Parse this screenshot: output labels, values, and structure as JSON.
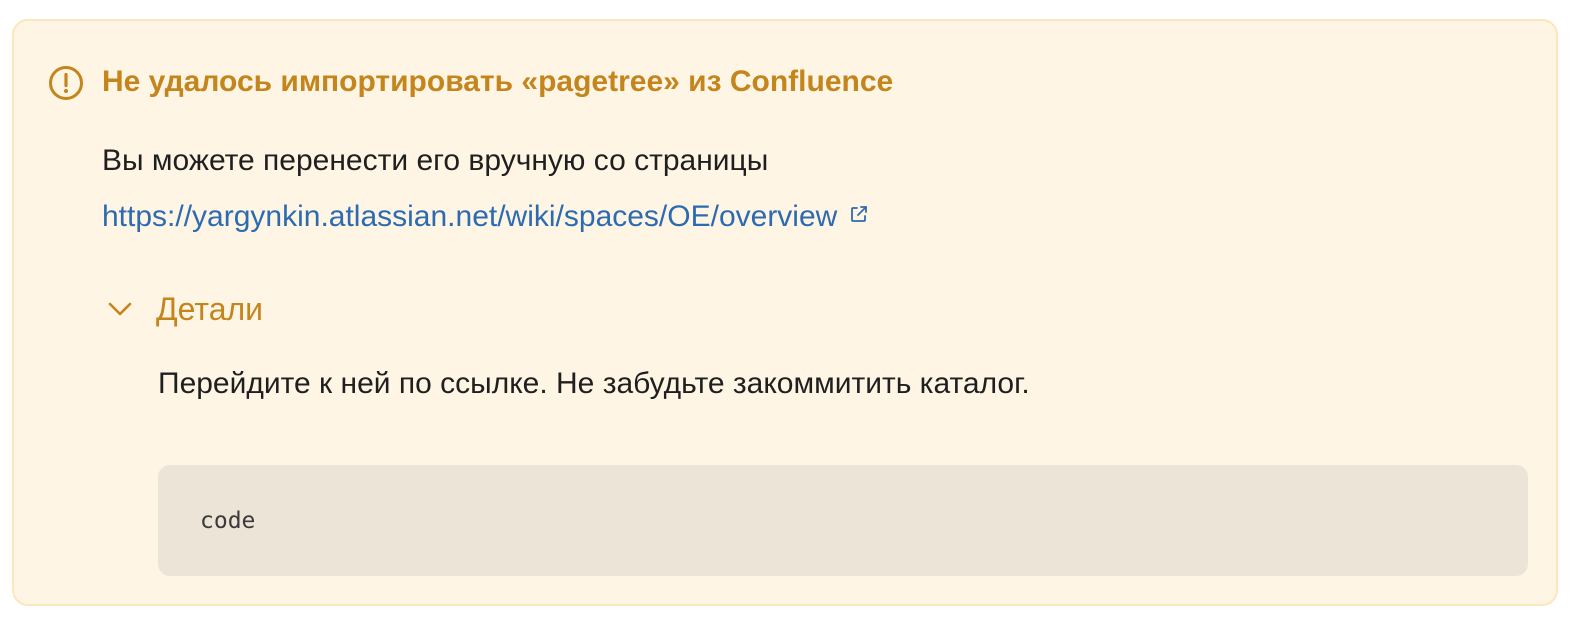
{
  "alert": {
    "icon": "exclamation-circle-icon",
    "title": "Не удалось импортировать «pagetree» из Confluence",
    "description": "Вы можете перенести его вручную со страницы",
    "link": {
      "text": "https://yargynkin.atlassian.net/wiki/spaces/OE/overview",
      "icon": "external-link-icon"
    },
    "details": {
      "label": "Детали",
      "expanded": true,
      "icon": "chevron-down-icon",
      "text": "Перейдите к ней по ссылке. Не забудьте закоммитить каталог.",
      "code": "code"
    }
  },
  "colors": {
    "background": "#fef5e5",
    "border": "#fbe7bd",
    "accent": "#c4851c",
    "link": "#2d6bb0",
    "code_background": "#ede4d8"
  }
}
